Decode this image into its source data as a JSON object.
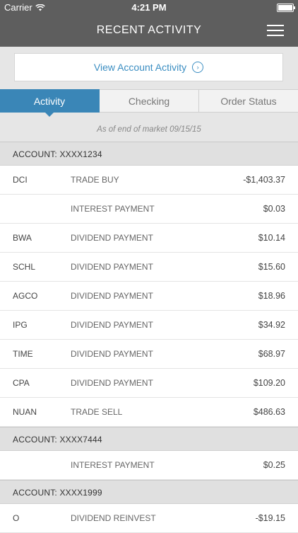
{
  "status_bar": {
    "carrier": "Carrier",
    "time": "4:21 PM"
  },
  "nav": {
    "title": "RECENT ACTIVITY",
    "menu_icon": "hamburger-menu-icon"
  },
  "view_account_activity": {
    "label": "View Account Activity",
    "icon": "circle-arrow-right-icon"
  },
  "tabs": [
    {
      "label": "Activity",
      "active": true
    },
    {
      "label": "Checking",
      "active": false
    },
    {
      "label": "Order Status",
      "active": false
    }
  ],
  "as_of": "As of end of market 09/15/15",
  "accounts": [
    {
      "header": "ACCOUNT: XXXX1234",
      "rows": [
        {
          "symbol": "DCI",
          "description": "TRADE BUY",
          "amount": "-$1,403.37"
        },
        {
          "symbol": "",
          "description": "INTEREST PAYMENT",
          "amount": "$0.03"
        },
        {
          "symbol": "BWA",
          "description": "DIVIDEND PAYMENT",
          "amount": "$10.14"
        },
        {
          "symbol": "SCHL",
          "description": "DIVIDEND PAYMENT",
          "amount": "$15.60"
        },
        {
          "symbol": "AGCO",
          "description": "DIVIDEND PAYMENT",
          "amount": "$18.96"
        },
        {
          "symbol": "IPG",
          "description": "DIVIDEND PAYMENT",
          "amount": "$34.92"
        },
        {
          "symbol": "TIME",
          "description": "DIVIDEND PAYMENT",
          "amount": "$68.97"
        },
        {
          "symbol": "CPA",
          "description": "DIVIDEND PAYMENT",
          "amount": "$109.20"
        },
        {
          "symbol": "NUAN",
          "description": "TRADE SELL",
          "amount": "$486.63"
        }
      ]
    },
    {
      "header": "ACCOUNT: XXXX7444",
      "rows": [
        {
          "symbol": "",
          "description": "INTEREST PAYMENT",
          "amount": "$0.25"
        }
      ]
    },
    {
      "header": "ACCOUNT: XXXX1999",
      "rows": [
        {
          "symbol": "O",
          "description": "DIVIDEND REINVEST",
          "amount": "-$19.15"
        }
      ]
    }
  ]
}
